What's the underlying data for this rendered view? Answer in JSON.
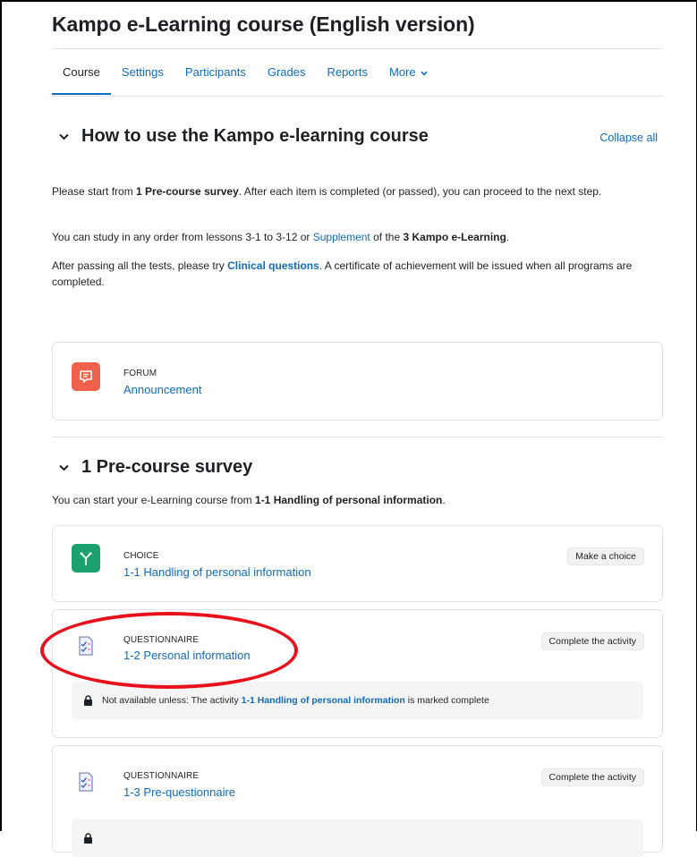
{
  "course": {
    "title": "Kampo e-Learning course (English version)"
  },
  "tabs": [
    {
      "label": "Course"
    },
    {
      "label": "Settings"
    },
    {
      "label": "Participants"
    },
    {
      "label": "Grades"
    },
    {
      "label": "Reports"
    },
    {
      "label": "More"
    }
  ],
  "section0": {
    "toggle_icon": "chevron-down-icon",
    "title": "How to use the Kampo e-learning course",
    "collapse_all": "Collapse all",
    "p1": {
      "a": "Please start from ",
      "b": "1 Pre-course survey",
      "c": ". After each item is completed (or passed), you can proceed to the next step."
    },
    "p2": {
      "a": "You can study in any order from lessons 3-1 to 3-12 or ",
      "link": "Supplement",
      "b": " of the ",
      "bold": "3 Kampo e-Learning",
      "c": "."
    },
    "p3": {
      "a": "After passing all the tests, please try ",
      "link": "Clinical questions",
      "b": ". A certificate of achievement will be issued when all programs are completed."
    },
    "forum": {
      "type": "FORUM",
      "name": "Announcement",
      "icon": "forum-icon",
      "color": "#f0614c"
    }
  },
  "section1": {
    "title": "1 Pre-course survey",
    "intro": {
      "a": "You can start your e-Learning course from ",
      "b": "1-1 Handling of personal information",
      "c": "."
    },
    "activities": [
      {
        "type": "CHOICE",
        "name": "1-1 Handling of personal information",
        "badge": "Make a choice",
        "icon": "choice-icon",
        "color": "#1ba06f"
      },
      {
        "type": "QUESTIONNAIRE",
        "name": "1-2 Personal information",
        "badge": "Complete the activity",
        "icon": "questionnaire-icon",
        "restriction": {
          "a": "Not available unless: The activity ",
          "link": "1-1 Handling of personal information",
          "b": " is marked complete"
        }
      },
      {
        "type": "QUESTIONNAIRE",
        "name": "1-3 Pre-questionnaire",
        "badge": "Complete the activity",
        "icon": "questionnaire-icon"
      }
    ]
  },
  "annotation": {
    "color": "#e8101b"
  }
}
